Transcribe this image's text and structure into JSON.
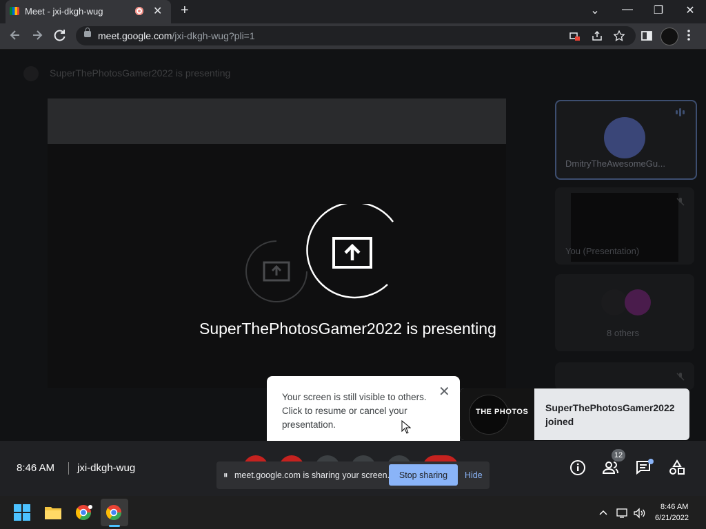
{
  "browser": {
    "tab_title": "Meet - jxi-dkgh-wug",
    "new_tab_symbol": "+",
    "tab_close_symbol": "✕",
    "url_host": "meet.google.com",
    "url_path": "/jxi-dkgh-wug?pli=1",
    "window_controls": [
      "⌄",
      "—",
      "❐",
      "✕"
    ]
  },
  "meet": {
    "presenter_header": "SuperThePhotosGamer2022 is presenting",
    "overlay_text": "SuperThePhotosGamer2022 is presenting",
    "tiles": {
      "dmitry_name": "DmitryTheAwesomeGu...",
      "you_name": "You (Presentation)",
      "others_label": "8 others"
    },
    "tooltip": {
      "text": "Your screen is still visible to others. Click to resume or cancel your presentation.",
      "close_symbol": "✕"
    },
    "joined_notification": {
      "logo_text": "THE PHOTOS",
      "text": "SuperThePhotosGamer2022 joined"
    },
    "bottom_bar": {
      "time": "8:46 AM",
      "meeting_code": "jxi-dkgh-wug",
      "people_count": "12"
    },
    "share_bar": {
      "pause_symbol": "⏸",
      "message": "meet.google.com is sharing your screen.",
      "stop_label": "Stop sharing",
      "hide_label": "Hide"
    }
  },
  "taskbar": {
    "time": "8:46 AM",
    "date": "6/21/2022"
  },
  "colors": {
    "accent_blue": "#8ab4f8",
    "meet_background": "#111214",
    "tooltip_background": "#ffffff"
  }
}
